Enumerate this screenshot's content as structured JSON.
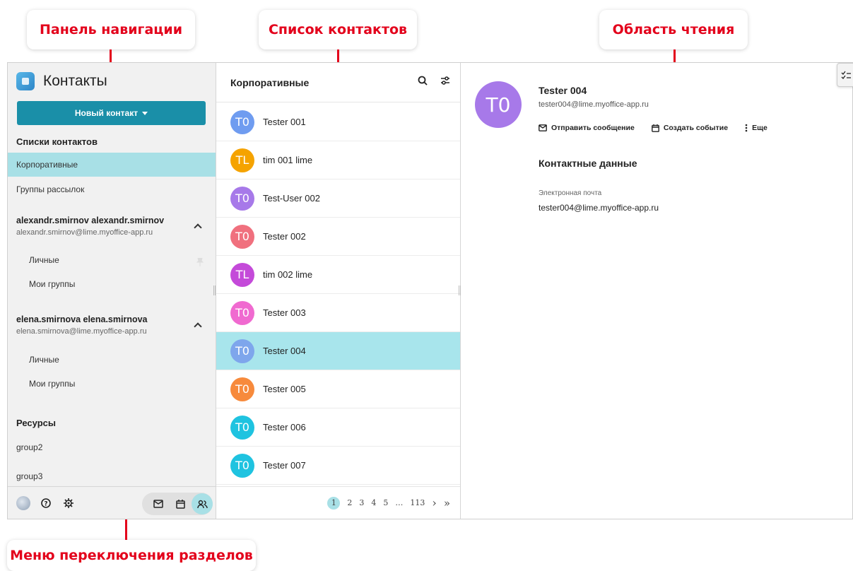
{
  "annotations": {
    "nav_panel": "Панель навигации",
    "contact_list": "Список контактов",
    "reading_area": "Область чтения",
    "section_switch": "Меню переключения разделов"
  },
  "sidebar": {
    "app_title": "Контакты",
    "new_contact_label": "Новый контакт",
    "lists_heading": "Списки контактов",
    "items": [
      {
        "label": "Корпоративные",
        "active": true
      },
      {
        "label": "Группы рассылок",
        "active": false
      }
    ],
    "accounts": [
      {
        "name": "alexandr.smirnov alexandr.smirnov",
        "email": "alexandr.smirnov@lime.myoffice-app.ru",
        "sub": [
          "Личные",
          "Мои группы"
        ]
      },
      {
        "name": "elena.smirnova elena.smirnova",
        "email": "elena.smirnova@lime.myoffice-app.ru",
        "sub": [
          "Личные",
          "Мои группы"
        ]
      }
    ],
    "resources_heading": "Ресурсы",
    "resources": [
      "group2",
      "group3"
    ]
  },
  "list": {
    "title": "Корпоративные",
    "contacts": [
      {
        "initials": "T0",
        "name": "Tester 001",
        "color": "#6f9cf0",
        "active": false
      },
      {
        "initials": "TL",
        "name": "tim 001 lime",
        "color": "#f5a300",
        "active": false
      },
      {
        "initials": "T0",
        "name": "Test-User 002",
        "color": "#a779e9",
        "active": false
      },
      {
        "initials": "T0",
        "name": "Tester 002",
        "color": "#f0707e",
        "active": false
      },
      {
        "initials": "TL",
        "name": "tim 002 lime",
        "color": "#c44ad9",
        "active": false
      },
      {
        "initials": "T0",
        "name": "Tester 003",
        "color": "#f06ad0",
        "active": false
      },
      {
        "initials": "T0",
        "name": "Tester 004",
        "color": "#7ea6ec",
        "active": true
      },
      {
        "initials": "T0",
        "name": "Tester 005",
        "color": "#f78a3c",
        "active": false
      },
      {
        "initials": "T0",
        "name": "Tester 006",
        "color": "#1fc3e0",
        "active": false
      },
      {
        "initials": "T0",
        "name": "Tester 007",
        "color": "#1fc3e0",
        "active": false
      }
    ],
    "pages": [
      "1",
      "2",
      "3",
      "4",
      "5",
      "…",
      "113"
    ],
    "current_page": "1"
  },
  "reader": {
    "initials": "T0",
    "name": "Tester 004",
    "email": "tester004@lime.myoffice-app.ru",
    "actions": [
      "Отправить сообщение",
      "Создать событие",
      "Еще"
    ],
    "section_title": "Контактные данные",
    "field_label": "Электронная почта",
    "field_value": "tester004@lime.myoffice-app.ru"
  },
  "colors": {
    "accent": "#1a8fa8",
    "highlight": "#a8e0e6",
    "annotation": "#e3001b"
  },
  "icons": [
    "search-icon",
    "filter-icon",
    "help-icon",
    "settings-icon",
    "mail-icon",
    "calendar-icon",
    "contacts-icon",
    "more-icon",
    "checklist-icon"
  ]
}
